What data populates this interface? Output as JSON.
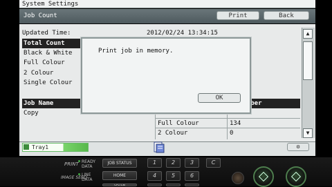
{
  "system_bar": {
    "title": "System Settings"
  },
  "header": {
    "title": "Job Count",
    "print_label": "Print",
    "back_label": "Back"
  },
  "info": {
    "updated_label": "Updated Time:",
    "updated_value": "2012/02/24 13:34:15"
  },
  "summary": {
    "header_label": "Total Count",
    "rows": [
      {
        "label": "Black & White"
      },
      {
        "label": "Full Colour"
      },
      {
        "label": "2 Colour"
      },
      {
        "label": "Single Colour"
      }
    ]
  },
  "job_table": {
    "headers": {
      "name": "Job Name",
      "number": "Number"
    },
    "rows": [
      {
        "name": "Copy",
        "type": "",
        "value": ""
      },
      {
        "name": "",
        "type": "Full Colour",
        "value": "134"
      },
      {
        "name": "",
        "type": "2 Colour",
        "value": "0"
      }
    ]
  },
  "bottom": {
    "tray_label": "Tray1"
  },
  "dialog": {
    "message": "Print job in memory.",
    "ok_label": "OK"
  },
  "panel": {
    "print_label": "PRINT",
    "image_send_label": "IMAGE SEND",
    "ready_label": "READY",
    "data_label": "DATA",
    "line_label": "LINE",
    "job_status_label": "JOB STATUS",
    "home_label": "HOME",
    "system_label": "SYSTEM",
    "keys_row1": [
      "1",
      "2",
      "3",
      "C"
    ],
    "keys_row2": [
      "4",
      "5",
      "6"
    ]
  },
  "colors": {
    "title_bar": "#5a6669",
    "accent_green": "#58b84c",
    "screen_bg": "#e8eaea"
  }
}
